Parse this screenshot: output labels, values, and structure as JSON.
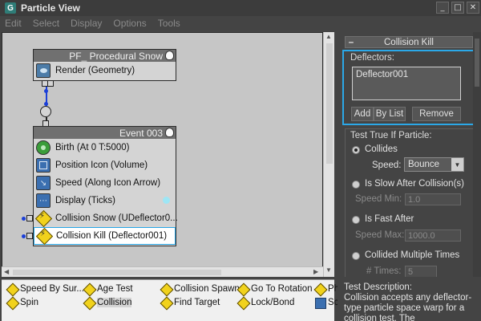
{
  "window": {
    "title": "Particle View",
    "app_icon": "G",
    "controls": [
      "_",
      "□",
      "✕"
    ]
  },
  "menu": [
    "Edit",
    "Select",
    "Display",
    "Options",
    "Tools"
  ],
  "graph": {
    "nodes": [
      {
        "title": "PF_ Procedural Snow",
        "operators": [
          {
            "label": "Render (Geometry)",
            "icon": "render-icon"
          }
        ]
      },
      {
        "title": "Event 003",
        "operators": [
          {
            "label": "Birth  (At 0 T:5000)",
            "icon": "birth-icon"
          },
          {
            "label": "Position Icon (Volume)",
            "icon": "position-icon"
          },
          {
            "label": "Speed  (Along Icon Arrow)",
            "icon": "speed-icon"
          },
          {
            "label": "Display  (Ticks)",
            "icon": "display-icon"
          },
          {
            "label": "Collision Snow (UDeflector0...",
            "icon": "test-icon"
          },
          {
            "label": "Collision Kill (Deflector001)",
            "icon": "test-icon",
            "selected": true
          }
        ]
      }
    ]
  },
  "panel": {
    "rollout_title": "Collision Kill",
    "deflectors": {
      "label": "Deflectors:",
      "items": [
        "Deflector001"
      ],
      "add_label": "Add",
      "by_list_label": "By List",
      "remove_label": "Remove"
    },
    "test": {
      "label": "Test True If Particle:",
      "collides_label": "Collides",
      "speed_label": "Speed:",
      "speed_value": "Bounce",
      "slow_label": "Is Slow After Collision(s)",
      "speed_min_label": "Speed Min:",
      "speed_min_value": "1.0",
      "fast_label": "Is Fast After",
      "speed_max_label": "Speed Max:",
      "speed_max_value": "1000.0",
      "multiple_label": "Collided Multiple Times",
      "times_label": "# Times:",
      "times_value": "5"
    }
  },
  "depot": {
    "row1": [
      "Speed By Sur...",
      "Age Test",
      "Collision Spawn",
      "Go To Rotation",
      "Ph"
    ],
    "row2": [
      "Spin",
      "Collision",
      "Find Target",
      "Lock/Bond",
      "Sc"
    ]
  },
  "description": {
    "title": "Test Description:",
    "text": "Collision accepts any deflector-type particle space warp for a collision test. The"
  },
  "colors": {
    "accent": "#2ba8e8",
    "wire": "#1b3fd8",
    "test_icon": "#f1d21c"
  }
}
